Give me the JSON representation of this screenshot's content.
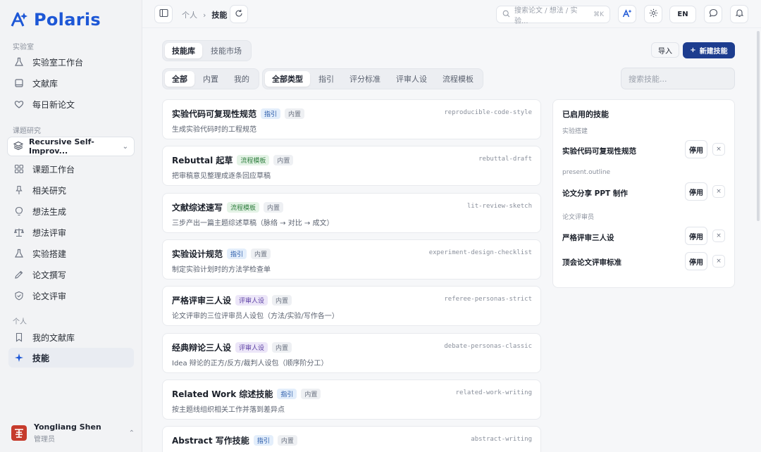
{
  "app": {
    "logo_text": "Polaris",
    "brand_color": "#1d57d6"
  },
  "sidebar": {
    "sections": [
      {
        "label": "实验室",
        "items": [
          {
            "label": "实验室工作台",
            "icon": "flask-icon"
          },
          {
            "label": "文献库",
            "icon": "book-icon"
          },
          {
            "label": "每日新论文",
            "icon": "heart-icon"
          }
        ]
      },
      {
        "label": "课题研究",
        "project": "Recursive Self-Improv...",
        "items": [
          {
            "label": "课题工作台",
            "icon": "grid-icon"
          },
          {
            "label": "相关研究",
            "icon": "pin-icon"
          },
          {
            "label": "想法生成",
            "icon": "bulb-icon"
          },
          {
            "label": "想法评审",
            "icon": "scale-icon"
          },
          {
            "label": "实验搭建",
            "icon": "flask-icon"
          },
          {
            "label": "论文撰写",
            "icon": "pen-icon"
          },
          {
            "label": "论文评审",
            "icon": "shield-icon"
          }
        ]
      },
      {
        "label": "个人",
        "items": [
          {
            "label": "我的文献库",
            "icon": "bookmark-icon"
          },
          {
            "label": "技能",
            "icon": "sparkle-icon",
            "active": true
          }
        ]
      }
    ],
    "user": {
      "name": "Yongliang Shen",
      "role": "管理员"
    }
  },
  "topbar": {
    "breadcrumb": [
      "个人",
      "技能"
    ],
    "search_placeholder": "搜索论文 / 想法 / 实验...",
    "search_shortcut": "⌘K",
    "lang": "EN"
  },
  "tabs": {
    "library": "技能库",
    "market": "技能市场"
  },
  "actions": {
    "import": "导入",
    "new_skill": "新建技能"
  },
  "filters": {
    "scope": [
      "全部",
      "内置",
      "我的"
    ],
    "types": [
      "全部类型",
      "指引",
      "评分标准",
      "评审人设",
      "流程模板"
    ]
  },
  "skill_search_placeholder": "搜索技能...",
  "skills": [
    {
      "title": "实验代码可复现性规范",
      "tag": "指引",
      "tag_kind": "guide",
      "builtin": "内置",
      "desc": "生成实验代码时的工程规范",
      "slug": "reproducible-code-style"
    },
    {
      "title": "Rebuttal 起草",
      "tag": "流程模板",
      "tag_kind": "flow",
      "builtin": "内置",
      "desc": "把审稿意见整理成逐条回应草稿",
      "slug": "rebuttal-draft"
    },
    {
      "title": "文献综述速写",
      "tag": "流程模板",
      "tag_kind": "flow",
      "builtin": "内置",
      "desc": "三步产出一篇主题综述草稿（脉络 → 对比 → 成文）",
      "slug": "lit-review-sketch"
    },
    {
      "title": "实验设计规范",
      "tag": "指引",
      "tag_kind": "guide",
      "builtin": "内置",
      "desc": "制定实验计划时的方法学检查单",
      "slug": "experiment-design-checklist"
    },
    {
      "title": "严格评审三人设",
      "tag": "评审人设",
      "tag_kind": "persona",
      "builtin": "内置",
      "desc": "论文评审的三位评审员人设包（方法/实验/写作各一）",
      "slug": "referee-personas-strict"
    },
    {
      "title": "经典辩论三人设",
      "tag": "评审人设",
      "tag_kind": "persona",
      "builtin": "内置",
      "desc": "Idea 辩论的正方/反方/裁判人设包（顺序阶分工）",
      "slug": "debate-personas-classic"
    },
    {
      "title": "Related Work 综述技能",
      "tag": "指引",
      "tag_kind": "guide",
      "builtin": "内置",
      "desc": "按主题线组织相关工作并落到差异点",
      "slug": "related-work-writing"
    },
    {
      "title": "Abstract 写作技能",
      "tag": "指引",
      "tag_kind": "guide",
      "builtin": "内置",
      "desc": "",
      "slug": "abstract-writing"
    }
  ],
  "enabled_panel": {
    "title": "已启用的技能",
    "stop_label": "停用",
    "remove_glyph": "×",
    "groups": [
      {
        "label": "实验搭建",
        "items": [
          "实验代码可复现性规范"
        ]
      },
      {
        "label": "present.outline",
        "items": [
          "论文分享 PPT 制作"
        ]
      },
      {
        "label": "论文评审员",
        "items": [
          "严格评审三人设",
          "顶会论文评审标准"
        ]
      }
    ]
  }
}
